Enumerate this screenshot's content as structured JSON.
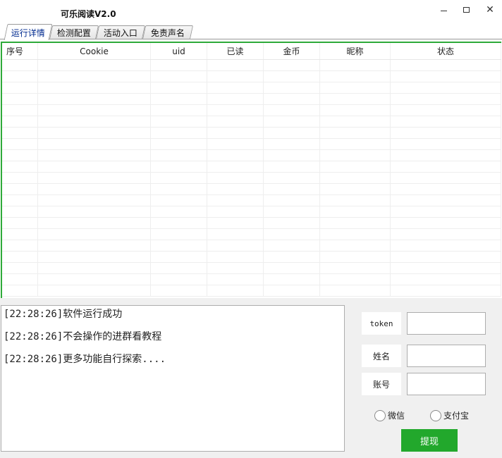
{
  "window": {
    "title": "可乐阅读V2.0",
    "min_icon": "minimize-icon",
    "max_icon": "maximize-icon",
    "close_icon": "close-icon",
    "close_glyph": "✕"
  },
  "tabs": [
    {
      "label": "运行详情",
      "active": true
    },
    {
      "label": "检测配置",
      "active": false
    },
    {
      "label": "活动入口",
      "active": false
    },
    {
      "label": "免责声名",
      "active": false
    }
  ],
  "table": {
    "columns": [
      "序号",
      "Cookie",
      "uid",
      "已读",
      "金币",
      "昵称",
      "状态"
    ],
    "rows": []
  },
  "log": {
    "lines": [
      "[22:28:26]软件运行成功",
      "[22:28:26]不会操作的进群看教程",
      "[22:28:26]更多功能自行探索...."
    ]
  },
  "form": {
    "token_label": "token",
    "token_value": "",
    "name_label": "姓名",
    "name_value": "",
    "account_label": "账号",
    "account_value": "",
    "radio_wechat": "微信",
    "radio_alipay": "支付宝",
    "withdraw_label": "提现"
  },
  "colors": {
    "accent_green": "#22a82c",
    "grid_border": "#2eaa3a",
    "active_tab_text": "#002a8f"
  }
}
